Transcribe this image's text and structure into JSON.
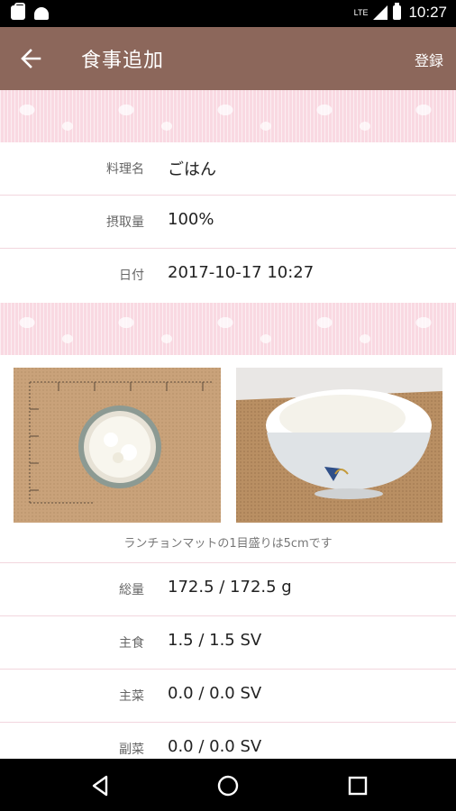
{
  "status_bar": {
    "time": "10:27",
    "network": "LTE",
    "left_icons": [
      "app-notification-icon",
      "android-icon"
    ]
  },
  "app_bar": {
    "title": "食事追加",
    "register_label": "登録",
    "back_icon": "arrow-left-icon",
    "color": "#8c675b"
  },
  "meal": {
    "name_label": "料理名",
    "name_value": "ごはん",
    "amount_label": "摂取量",
    "amount_value": "100%",
    "date_label": "日付",
    "date_value": "2017-10-17 10:27"
  },
  "photos": {
    "caption": "ランチョンマットの1目盛りは5cmです"
  },
  "nutrition": [
    {
      "label": "総量",
      "value": "172.5 / 172.5 g"
    },
    {
      "label": "主食",
      "value": "1.5 / 1.5 SV"
    },
    {
      "label": "主菜",
      "value": "0.0 / 0.0 SV"
    },
    {
      "label": "副菜",
      "value": "0.0 / 0.0 SV"
    }
  ],
  "nav_bar": {
    "icons": [
      "nav-back-icon",
      "nav-home-icon",
      "nav-recent-icon"
    ]
  }
}
